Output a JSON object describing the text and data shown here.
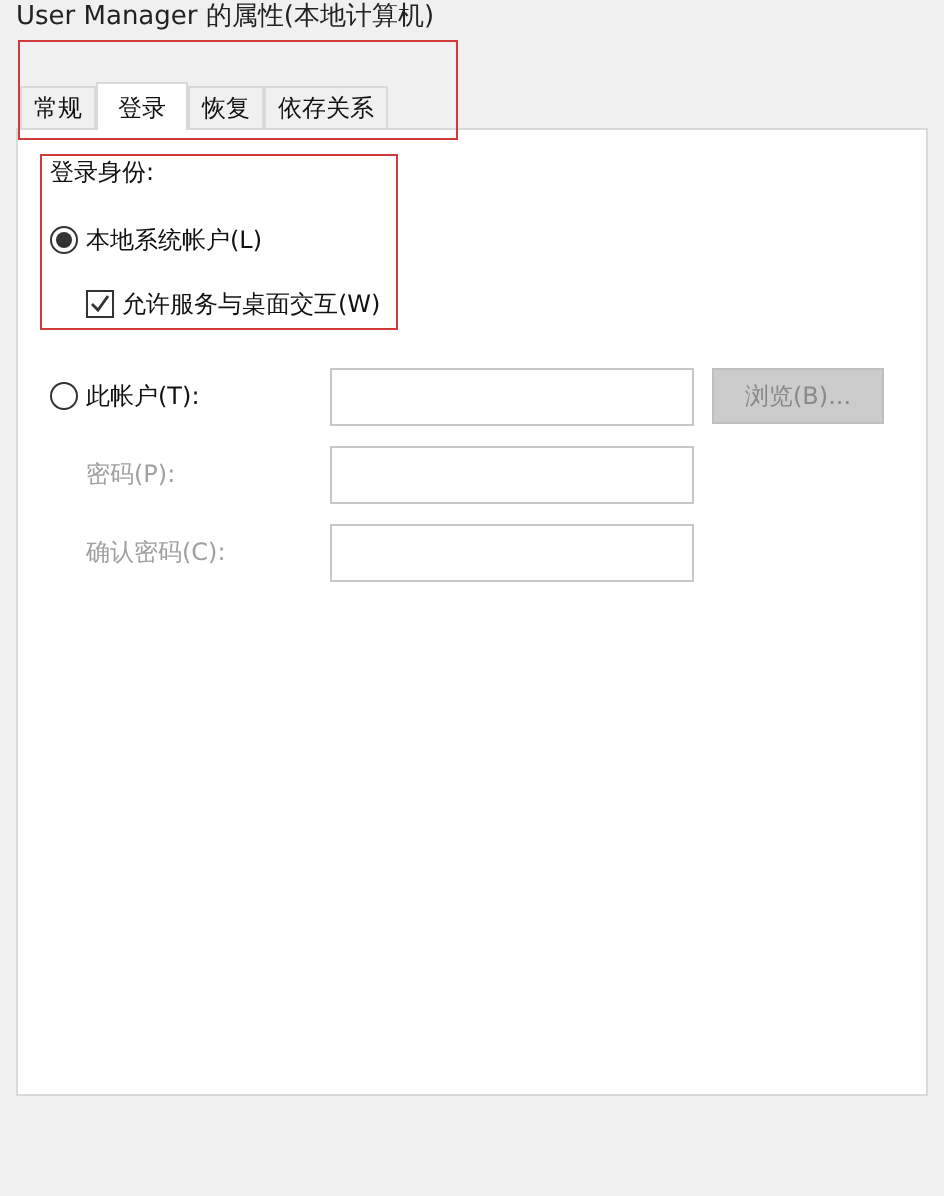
{
  "window": {
    "title": "User Manager 的属性(本地计算机)"
  },
  "tabs": [
    {
      "label": "常规",
      "selected": false
    },
    {
      "label": "登录",
      "selected": true
    },
    {
      "label": "恢复",
      "selected": false
    },
    {
      "label": "依存关系",
      "selected": false
    }
  ],
  "logon": {
    "heading": "登录身份:",
    "local_system": {
      "label": "本地系统帐户(L)",
      "selected": true
    },
    "interact": {
      "label": "允许服务与桌面交互(W)",
      "checked": true
    },
    "this_account": {
      "label": "此帐户(T):",
      "selected": false
    },
    "browse_button": {
      "label": "浏览(B)...",
      "disabled": true
    },
    "password": {
      "label": "密码(P):",
      "disabled": true
    },
    "confirm_password": {
      "label": "确认密码(C):",
      "disabled": true
    }
  }
}
